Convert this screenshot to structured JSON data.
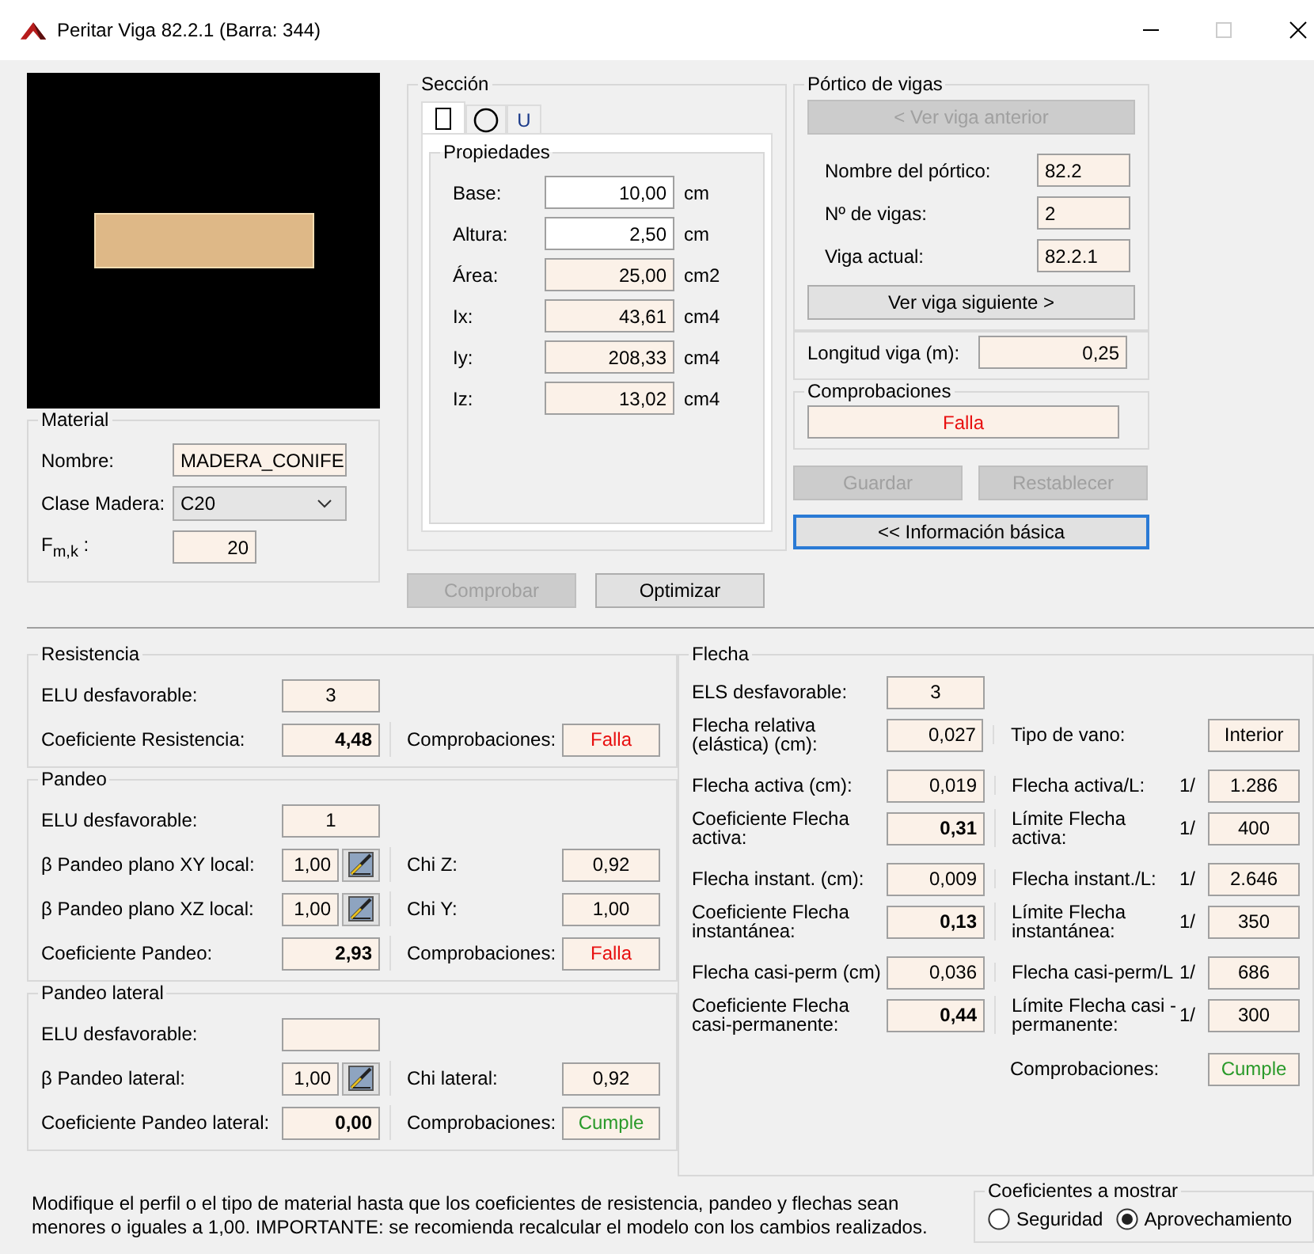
{
  "window": {
    "title": "Peritar Viga 82.2.1 (Barra: 344)"
  },
  "material": {
    "title": "Material",
    "fields": [
      {
        "kind": "text",
        "label": "Nombre:",
        "value": "MADERA_CONIFE"
      },
      {
        "kind": "select",
        "label": "Clase Madera:",
        "value": "C20"
      },
      {
        "kind": "number",
        "label": "F$_{m,k}$ :",
        "value": "20"
      }
    ]
  },
  "seccion": {
    "title": "Sección",
    "tabs": [
      {
        "kind": "rect",
        "selected": true
      },
      {
        "kind": "circle",
        "selected": false
      },
      {
        "kind": "text",
        "label": "U",
        "selected": false
      }
    ],
    "properties": {
      "title": "Propiedades",
      "rows": [
        {
          "label": "Base:",
          "value": "10,00",
          "unit": "cm",
          "editable": true
        },
        {
          "label": "Altura:",
          "value": "2,50",
          "unit": "cm",
          "editable": true
        },
        {
          "label": "Área:",
          "value": "25,00",
          "unit": "cm2",
          "editable": false
        },
        {
          "label": "Ix:",
          "value": "43,61",
          "unit": "cm4",
          "editable": false
        },
        {
          "label": "Iy:",
          "value": "208,33",
          "unit": "cm4",
          "editable": false
        },
        {
          "label": "Iz:",
          "value": "13,02",
          "unit": "cm4",
          "editable": false
        }
      ]
    }
  },
  "buttons": [
    {
      "label": "Comprobar",
      "disabled": true
    },
    {
      "label": "Optimizar",
      "disabled": false
    }
  ],
  "portico": {
    "title": "Pórtico de vigas",
    "prev": {
      "label": "< Ver viga anterior",
      "disabled": true
    },
    "fields": [
      {
        "label": "Nombre del pórtico:",
        "value": "82.2"
      },
      {
        "label": "Nº de vigas:",
        "value": "2"
      },
      {
        "label": "Viga actual:",
        "value": "82.2.1"
      }
    ],
    "next": {
      "label": "Ver viga siguiente >",
      "disabled": false
    }
  },
  "longitud": {
    "label": "Longitud viga (m):",
    "value": "0,25"
  },
  "comprobaciones": {
    "title": "Comprobaciones",
    "value": "Falla",
    "passed": false
  },
  "actions": [
    {
      "label": "Guardar",
      "disabled": true
    },
    {
      "label": "Restablecer",
      "disabled": true
    }
  ],
  "info_button": {
    "label": "<< Información básica",
    "focused": true
  },
  "left_panels": [
    {
      "title": "Resistencia",
      "rows": [
        {
          "left": {
            "kind": "index",
            "label": "ELU desfavorable:",
            "value": "3"
          }
        },
        {
          "left": {
            "kind": "coefficient",
            "label": "Coeficiente Resistencia:",
            "value": "4,48"
          },
          "right": {
            "kind": "status",
            "label": "Comprobaciones:",
            "value": "Falla",
            "passed": false
          }
        }
      ]
    },
    {
      "title": "Pandeo",
      "rows": [
        {
          "left": {
            "kind": "index",
            "label": "ELU desfavorable:",
            "value": "1"
          }
        },
        {
          "left": {
            "kind": "beta",
            "label": "β Pandeo plano XY local:",
            "value": "1,00"
          },
          "right": {
            "kind": "ratio",
            "label": "Chi Z:",
            "value": "0,92"
          }
        },
        {
          "left": {
            "kind": "beta",
            "label": "β Pandeo plano XZ local:",
            "value": "1,00"
          },
          "right": {
            "kind": "ratio",
            "label": "Chi Y:",
            "value": "1,00"
          }
        },
        {
          "left": {
            "kind": "coefficient",
            "label": "Coeficiente Pandeo:",
            "value": "2,93"
          },
          "right": {
            "kind": "status",
            "label": "Comprobaciones:",
            "value": "Falla",
            "passed": false
          }
        }
      ]
    },
    {
      "title": "Pandeo lateral",
      "rows": [
        {
          "left": {
            "kind": "index",
            "label": "ELU desfavorable:"
          }
        },
        {
          "left": {
            "kind": "beta",
            "label": "β Pandeo lateral:",
            "value": "1,00"
          },
          "right": {
            "kind": "ratio",
            "label": "Chi lateral:",
            "value": "0,92"
          }
        },
        {
          "left": {
            "kind": "coefficient",
            "label": "Coeficiente Pandeo lateral:",
            "value": "0,00"
          },
          "right": {
            "kind": "status",
            "label": "Comprobaciones:",
            "value": "Cumple",
            "passed": true
          }
        }
      ]
    }
  ],
  "flecha": {
    "title": "Flecha",
    "groups": [
      [
        {
          "left": {
            "kind": "index",
            "label": "ELS desfavorable:",
            "value": "3"
          }
        },
        {
          "left": {
            "kind": "measure",
            "label": "Flecha relativa (elástica) (cm):",
            "value": "0,027"
          },
          "right": {
            "kind": "ratio",
            "label": "Tipo de vano:",
            "value": "Interior"
          }
        }
      ],
      [
        {
          "left": {
            "kind": "measure",
            "label": "Flecha activa (cm):",
            "value": "0,019"
          },
          "right": {
            "kind": "ratio",
            "label": "Flecha activa/L:",
            "prefix": "1/",
            "value": "1.286"
          }
        },
        {
          "left": {
            "kind": "coefficient",
            "label": "Coeficiente Flecha activa:",
            "value": "0,31"
          },
          "right": {
            "kind": "ratio",
            "label": "Límite Flecha activa:",
            "prefix": "1/",
            "value": "400"
          }
        }
      ],
      [
        {
          "left": {
            "kind": "measure",
            "label": "Flecha instant. (cm):",
            "value": "0,009"
          },
          "right": {
            "kind": "ratio",
            "label": "Flecha instant./L:",
            "prefix": "1/",
            "value": "2.646"
          }
        },
        {
          "left": {
            "kind": "coefficient",
            "label": "Coeficiente Flecha instantánea:",
            "value": "0,13"
          },
          "right": {
            "kind": "ratio",
            "label": "Límite Flecha instantánea:",
            "prefix": "1/",
            "value": "350"
          }
        }
      ],
      [
        {
          "left": {
            "kind": "measure",
            "label": "Flecha casi-perm (cm)",
            "value": "0,036"
          },
          "right": {
            "kind": "ratio",
            "label": "Flecha casi-perm/L",
            "prefix": "1/",
            "value": "686"
          }
        },
        {
          "left": {
            "kind": "coefficient",
            "label": "Coeficiente Flecha casi-permanente:",
            "value": "0,44"
          },
          "right": {
            "kind": "ratio",
            "label": "Límite Flecha casi -permanente:",
            "prefix": "1/",
            "value": "300"
          }
        }
      ]
    ],
    "result": {
      "kind": "status",
      "label": "Comprobaciones:",
      "value": "Cumple",
      "passed": true
    }
  },
  "footer": {
    "note": "Modifique el perfil o el tipo de material hasta que los coeficientes de resistencia, pandeo y flechas sean menores o iguales a 1,00. IMPORTANTE: se recomienda recalcular el modelo con los cambios realizados.",
    "display": {
      "title": "Coeficientes a mostrar",
      "options": [
        {
          "label": "Seguridad",
          "selected": false
        },
        {
          "label": "Aprovechamiento",
          "selected": true
        }
      ]
    }
  }
}
